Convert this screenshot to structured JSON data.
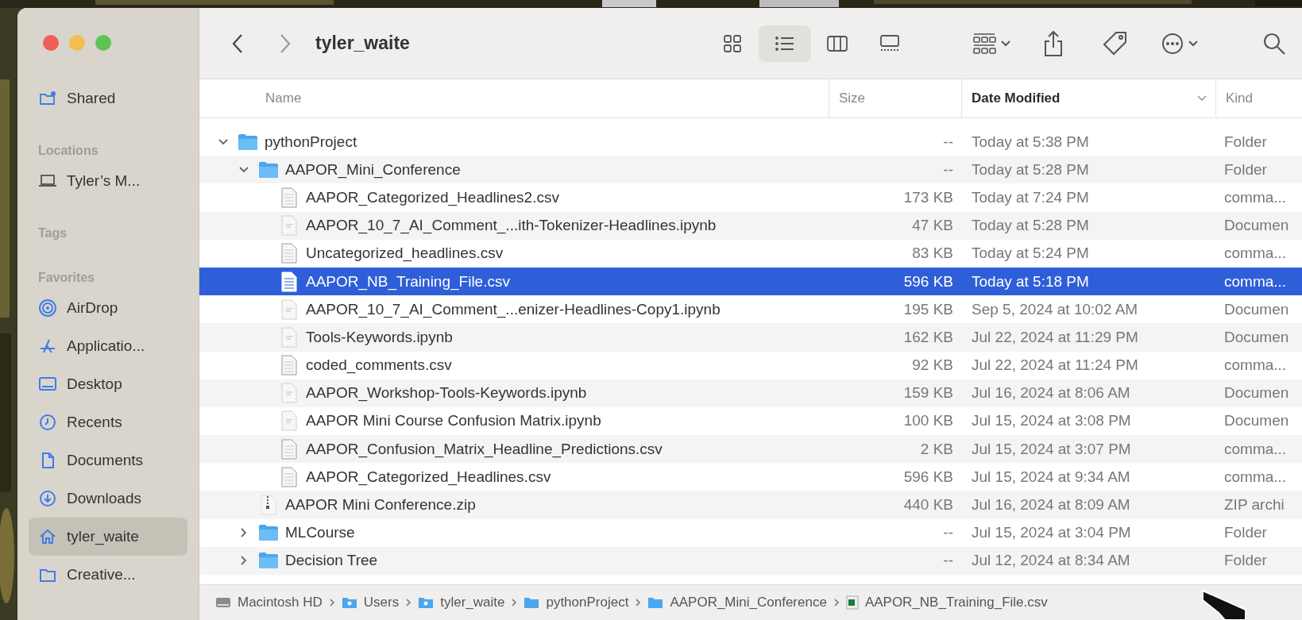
{
  "window": {
    "title": "tyler_waite"
  },
  "toolbar": {
    "view_modes": [
      {
        "kind": "icons",
        "selected": false
      },
      {
        "kind": "list",
        "selected": true
      },
      {
        "kind": "columns",
        "selected": false
      },
      {
        "kind": "gallery",
        "selected": false
      }
    ]
  },
  "sidebar": {
    "sections": [
      {
        "items": [
          {
            "label": "Shared",
            "kind": "shared",
            "selected": false
          }
        ]
      },
      {
        "heading": "Locations",
        "items": [
          {
            "label": "Tyler’s M...",
            "kind": "laptop",
            "selected": false
          }
        ]
      },
      {
        "heading": "Tags"
      },
      {
        "heading": "Favorites",
        "items": [
          {
            "label": "AirDrop",
            "kind": "airdrop",
            "selected": false
          },
          {
            "label": "Applicatio...",
            "kind": "apps",
            "selected": false
          },
          {
            "label": "Desktop",
            "kind": "desktop",
            "selected": false
          },
          {
            "label": "Recents",
            "kind": "clock",
            "selected": false
          },
          {
            "label": "Documents",
            "kind": "document",
            "selected": false
          },
          {
            "label": "Downloads",
            "kind": "download",
            "selected": false
          },
          {
            "label": "tyler_waite",
            "kind": "home",
            "selected": true
          },
          {
            "label": "Creative...",
            "kind": "folder",
            "selected": false
          }
        ]
      }
    ]
  },
  "columns": [
    {
      "label": "Name",
      "sorted": false
    },
    {
      "label": "Size",
      "sorted": false
    },
    {
      "label": "Date Modified",
      "sorted": true
    },
    {
      "label": "Kind",
      "sorted": false
    }
  ],
  "rows": [
    {
      "name": "pythonProject",
      "kind": "folder",
      "size": "--",
      "date": "Today at 5:38 PM",
      "type": "Folder",
      "expanded": true,
      "selected": false,
      "children": [
        {
          "name": "AAPOR_Mini_Conference",
          "kind": "folder",
          "size": "--",
          "date": "Today at 5:28 PM",
          "type": "Folder",
          "expanded": true,
          "selected": false,
          "children": [
            {
              "name": "AAPOR_Categorized_Headlines2.csv",
              "kind": "csv",
              "size": "173 KB",
              "date": "Today at 7:24 PM",
              "type": "comma...",
              "selected": false
            },
            {
              "name": "AAPOR_10_7_AI_Comment_...ith-Tokenizer-Headlines.ipynb",
              "kind": "notebook",
              "size": "47 KB",
              "date": "Today at 5:28 PM",
              "type": "Documen",
              "selected": false
            },
            {
              "name": "Uncategorized_headlines.csv",
              "kind": "csv",
              "size": "83 KB",
              "date": "Today at 5:24 PM",
              "type": "comma...",
              "selected": false
            },
            {
              "name": "AAPOR_NB_Training_File.csv",
              "kind": "csv",
              "size": "596 KB",
              "date": "Today at 5:18 PM",
              "type": "comma...",
              "selected": true
            },
            {
              "name": "AAPOR_10_7_AI_Comment_...enizer-Headlines-Copy1.ipynb",
              "kind": "notebook",
              "size": "195 KB",
              "date": "Sep 5, 2024 at 10:02 AM",
              "type": "Documen",
              "selected": false
            },
            {
              "name": "Tools-Keywords.ipynb",
              "kind": "notebook",
              "size": "162 KB",
              "date": "Jul 22, 2024 at 11:29 PM",
              "type": "Documen",
              "selected": false
            },
            {
              "name": "coded_comments.csv",
              "kind": "csv",
              "size": "92 KB",
              "date": "Jul 22, 2024 at 11:24 PM",
              "type": "comma...",
              "selected": false
            },
            {
              "name": "AAPOR_Workshop-Tools-Keywords.ipynb",
              "kind": "notebook",
              "size": "159 KB",
              "date": "Jul 16, 2024 at 8:06 AM",
              "type": "Documen",
              "selected": false
            },
            {
              "name": "AAPOR Mini Course Confusion Matrix.ipynb",
              "kind": "notebook",
              "size": "100 KB",
              "date": "Jul 15, 2024 at 3:08 PM",
              "type": "Documen",
              "selected": false
            },
            {
              "name": "AAPOR_Confusion_Matrix_Headline_Predictions.csv",
              "kind": "csv",
              "size": "2 KB",
              "date": "Jul 15, 2024 at 3:07 PM",
              "type": "comma...",
              "selected": false
            },
            {
              "name": "AAPOR_Categorized_Headlines.csv",
              "kind": "csv",
              "size": "596 KB",
              "date": "Jul 15, 2024 at 9:34 AM",
              "type": "comma...",
              "selected": false
            }
          ]
        },
        {
          "name": "AAPOR Mini Conference.zip",
          "kind": "zip",
          "size": "440 KB",
          "date": "Jul 16, 2024 at 8:09 AM",
          "type": "ZIP archi",
          "selected": false
        },
        {
          "name": "MLCourse",
          "kind": "folder",
          "size": "--",
          "date": "Jul 15, 2024 at 3:04 PM",
          "type": "Folder",
          "expanded": false,
          "selected": false
        },
        {
          "name": "Decision Tree",
          "kind": "folder",
          "size": "--",
          "date": "Jul 12, 2024 at 8:34 AM",
          "type": "Folder",
          "expanded": false,
          "selected": false
        }
      ]
    }
  ],
  "path_bar": [
    {
      "label": "Macintosh HD",
      "kind": "disk"
    },
    {
      "label": "Users",
      "kind": "user-folder"
    },
    {
      "label": "tyler_waite",
      "kind": "user-folder"
    },
    {
      "label": "pythonProject",
      "kind": "folder"
    },
    {
      "label": "AAPOR_Mini_Conference",
      "kind": "folder"
    },
    {
      "label": "AAPOR_NB_Training_File.csv",
      "kind": "spreadsheet"
    }
  ]
}
